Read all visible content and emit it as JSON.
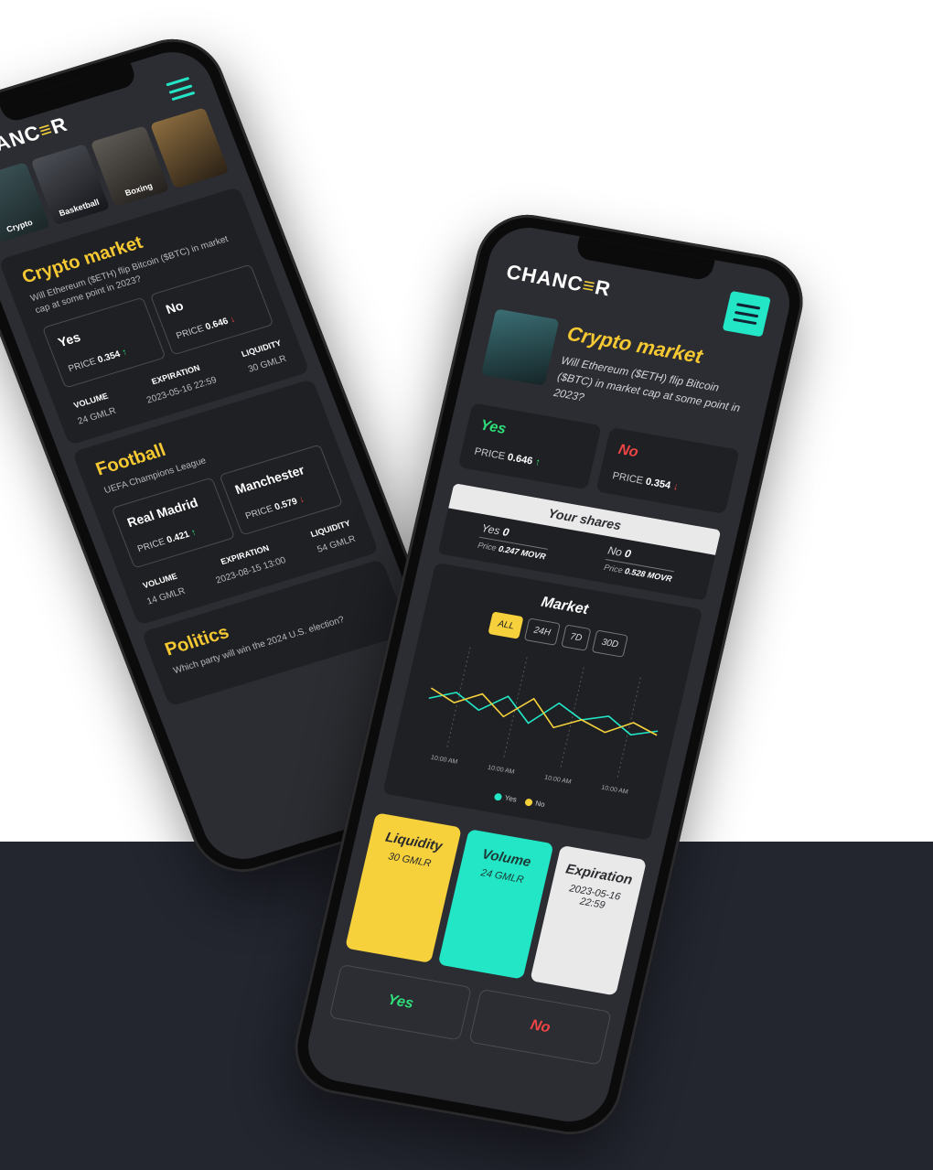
{
  "brand": {
    "logo_pre": "CHANC",
    "logo_coin": "≡",
    "logo_post": "R"
  },
  "colors": {
    "accent_teal": "#22e6c6",
    "accent_yellow": "#f6d13c",
    "up_green": "#2fe07a",
    "down_red": "#ef4545",
    "background_band": "#23252f"
  },
  "left_phone": {
    "categories": [
      {
        "label": "Crypto"
      },
      {
        "label": "Basketball"
      },
      {
        "label": "Boxing"
      },
      {
        "label": ""
      }
    ],
    "cards": [
      {
        "title": "Crypto market",
        "question": "Will Ethereum ($ETH) flip Bitcoin ($BTC) in market cap at some point in 2023?",
        "options": [
          {
            "label": "Yes",
            "price_label": "PRICE",
            "price": "0.354",
            "trend": "up"
          },
          {
            "label": "No",
            "price_label": "PRICE",
            "price": "0.646",
            "trend": "down"
          }
        ],
        "stats": [
          {
            "key": "VOLUME",
            "value": "24 GMLR"
          },
          {
            "key": "EXPIRATION",
            "value": "2023-05-16 22:59"
          },
          {
            "key": "LIQUIDITY",
            "value": "30 GMLR"
          }
        ]
      },
      {
        "title": "Football",
        "question": "UEFA Champions League",
        "options": [
          {
            "label": "Real Madrid",
            "price_label": "PRICE",
            "price": "0.421",
            "trend": "up"
          },
          {
            "label": "Manchester",
            "price_label": "PRICE",
            "price": "0.579",
            "trend": "down"
          }
        ],
        "stats": [
          {
            "key": "VOLUME",
            "value": "14 GMLR"
          },
          {
            "key": "EXPIRATION",
            "value": "2023-08-15 13:00"
          },
          {
            "key": "LIQUIDITY",
            "value": "54 GMLR"
          }
        ]
      },
      {
        "title": "Politics",
        "question": "Which party will win the 2024 U.S. election?"
      }
    ]
  },
  "right_phone": {
    "title": "Crypto market",
    "question": "Will Ethereum ($ETH) flip Bitcoin ($BTC) in market cap at some point in 2023?",
    "yes": {
      "label": "Yes",
      "price_label": "PRICE",
      "price": "0.646",
      "trend": "up"
    },
    "no": {
      "label": "No",
      "price_label": "PRICE",
      "price": "0.354",
      "trend": "down"
    },
    "shares": {
      "header": "Your shares",
      "yes_label": "Yes",
      "yes_count": "0",
      "yes_price_label": "Price",
      "yes_price": "0.247 MOVR",
      "no_label": "No",
      "no_count": "0",
      "no_price_label": "Price",
      "no_price": "0.528 MOVR"
    },
    "market": {
      "title": "Market",
      "ranges": [
        "ALL",
        "24H",
        "7D",
        "30D"
      ],
      "selected_range": "ALL",
      "legend_yes": "Yes",
      "legend_no": "No"
    },
    "tiles": [
      {
        "key": "Liquidity",
        "value": "30 GMLR"
      },
      {
        "key": "Volume",
        "value": "24 GMLR"
      },
      {
        "key": "Expiration",
        "value": "2023-05-16 22:59"
      }
    ],
    "trade": {
      "yes": "Yes",
      "no": "No"
    }
  },
  "chart_data": {
    "type": "line",
    "x": [
      "10:00 AM",
      "10:00 AM",
      "10:00 AM",
      "10:00 AM"
    ],
    "series": [
      {
        "name": "Yes",
        "color": "#22e6c6",
        "values": [
          0.45,
          0.55,
          0.42,
          0.6,
          0.38,
          0.62,
          0.5,
          0.58,
          0.44,
          0.52
        ]
      },
      {
        "name": "No",
        "color": "#f6d13c",
        "values": [
          0.55,
          0.45,
          0.58,
          0.4,
          0.62,
          0.38,
          0.5,
          0.42,
          0.56,
          0.48
        ]
      }
    ]
  }
}
